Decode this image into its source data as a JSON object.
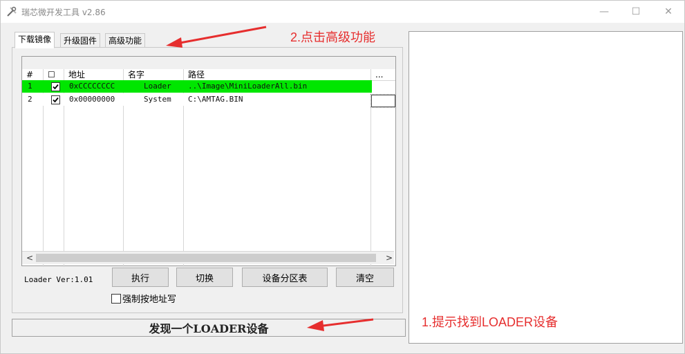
{
  "window": {
    "title": "瑞芯微开发工具 v2.86",
    "controls": {
      "minimize": "—",
      "maximize": "☐",
      "close": "✕"
    }
  },
  "tabs": [
    {
      "label": "下载镜像",
      "active": true
    },
    {
      "label": "升级固件",
      "active": false
    },
    {
      "label": "高级功能",
      "active": false
    }
  ],
  "table": {
    "headers": [
      "#",
      "☐",
      "地址",
      "名字",
      "路径",
      "..."
    ],
    "rows": [
      {
        "index": "1",
        "checked": true,
        "address": "0xCCCCCCCC",
        "name": "Loader",
        "path": "..\\Image\\MiniLoaderAll.bin"
      },
      {
        "index": "2",
        "checked": true,
        "address": "0x00000000",
        "name": "System",
        "path": "C:\\AMTAG.BIN"
      }
    ]
  },
  "scrollbar": {
    "left": "<",
    "right": ">"
  },
  "loader_version": "Loader Ver:1.01",
  "buttons": {
    "execute": "执行",
    "switch": "切换",
    "partition_table": "设备分区表",
    "clear": "清空"
  },
  "force_write_label": "强制按地址写",
  "status_text": "发现一个LOADER设备",
  "annotations": {
    "click_advanced": "2.点击高级功能",
    "found_loader": "1.提示找到LOADER设备"
  },
  "colors": {
    "annotation_red": "#e62e2e",
    "row_highlight_green": "#00e600"
  }
}
